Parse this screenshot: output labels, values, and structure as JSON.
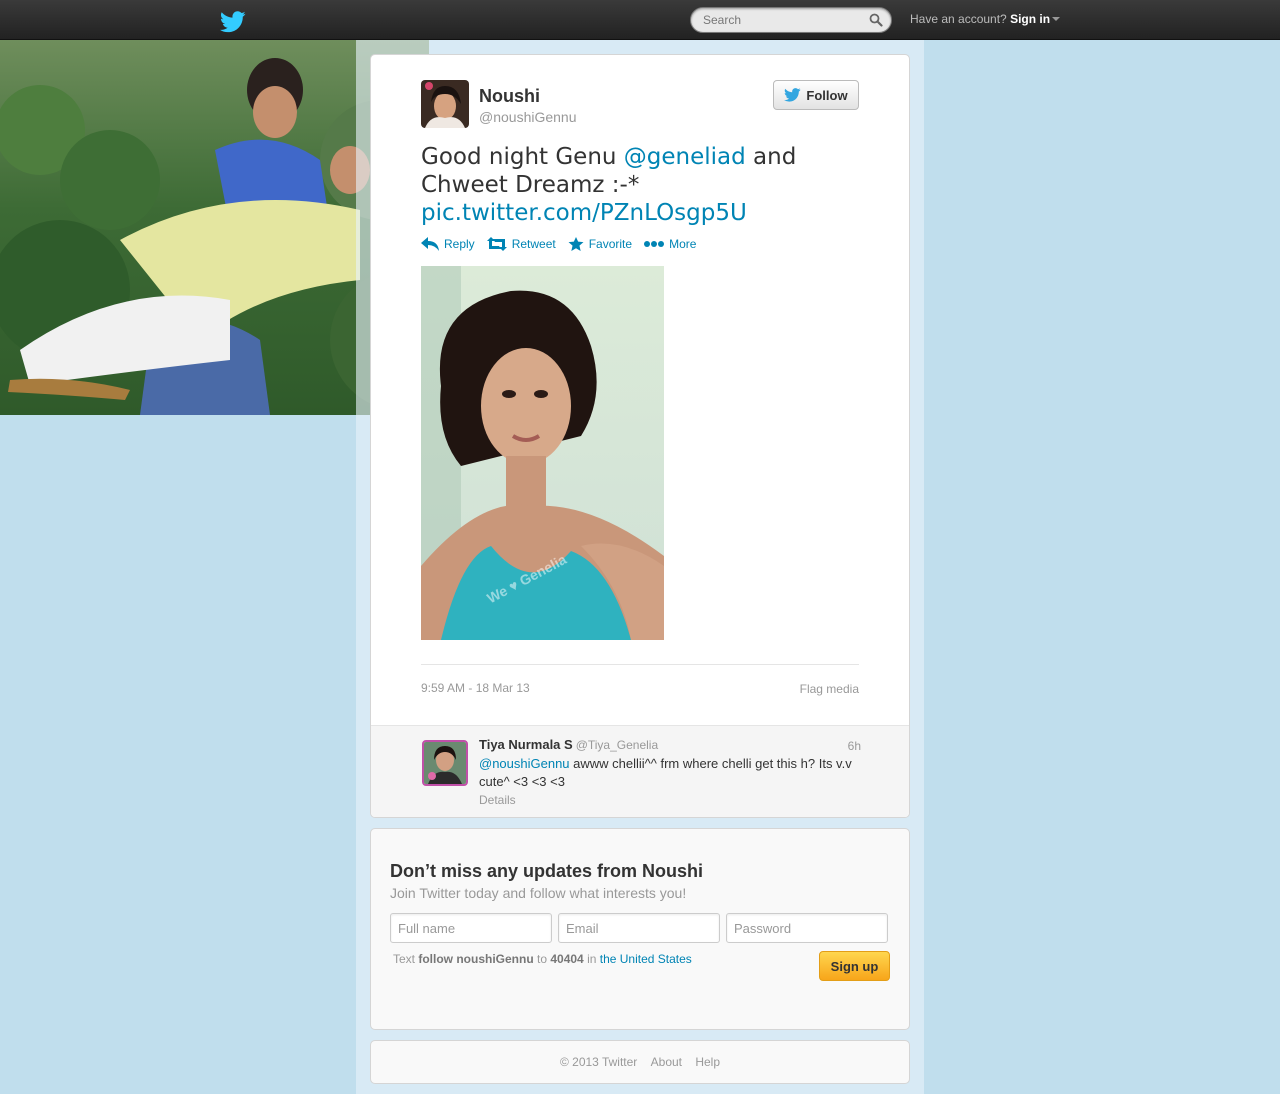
{
  "topbar": {
    "search_placeholder": "Search",
    "account_prompt": "Have an account?",
    "signin_label": "Sign in"
  },
  "tweet": {
    "author_name": "Noushi",
    "author_handle": "@noushiGennu",
    "follow_label": "Follow",
    "text_part1": "Good night Genu ",
    "mention": "@geneliad",
    "text_part2": " and Chweet Dreamz :-* ",
    "link": "pic.twitter.com/PZnLOsgp5U",
    "actions": {
      "reply": "Reply",
      "retweet": "Retweet",
      "favorite": "Favorite",
      "more": "More"
    },
    "timestamp": "9:59 AM - 18 Mar 13",
    "flag_media": "Flag media"
  },
  "reply": {
    "name": "Tiya Nurmala S",
    "handle": "@Tiya_Genelia",
    "time": "6h",
    "mention": "@noushiGennu",
    "text": " awww chellii^^ frm where chelli get this h? Its v.v cute^ <3 <3 <3",
    "details": "Details"
  },
  "signup": {
    "title": "Don’t miss any updates from Noushi",
    "subtitle": "Join Twitter today and follow what interests you!",
    "fullname_placeholder": "Full name",
    "email_placeholder": "Email",
    "password_placeholder": "Password",
    "sms_prefix": "Text ",
    "sms_command": "follow noushiGennu",
    "sms_to": " to ",
    "sms_number": "40404",
    "sms_in": " in ",
    "sms_country": "the United States",
    "button": "Sign up"
  },
  "footer": {
    "copyright": "© 2013 Twitter",
    "about": "About",
    "help": "Help"
  },
  "colors": {
    "link": "#0084b4",
    "page_background": "#c0deed",
    "signup_button": "#f7a51a"
  }
}
